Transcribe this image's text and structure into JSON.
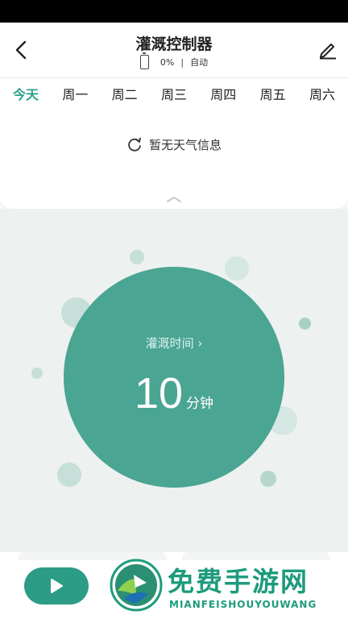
{
  "header": {
    "title": "灌溉控制器",
    "battery_percent": "0%",
    "separator": "|",
    "mode": "自动"
  },
  "tabs": [
    {
      "label": "今天",
      "active": true
    },
    {
      "label": "周一",
      "active": false
    },
    {
      "label": "周二",
      "active": false
    },
    {
      "label": "周三",
      "active": false
    },
    {
      "label": "周四",
      "active": false
    },
    {
      "label": "周五",
      "active": false
    },
    {
      "label": "周六",
      "active": false
    }
  ],
  "weather": {
    "message": "暂无天气信息",
    "icon": "refresh-icon"
  },
  "irrigation": {
    "label": "灌溉时间",
    "chevron": "›",
    "duration_value": "10",
    "duration_unit": "分钟"
  },
  "watermark": {
    "title": "免费手游网",
    "subtitle": "MIANFEISHOUYOUWANG"
  },
  "colors": {
    "accent": "#27a08a",
    "circle": "#4aa593",
    "background": "#edf1ef",
    "bubble": "#c6dfd9"
  },
  "icons": {
    "back": "chevron-left-icon",
    "edit": "pencil-icon",
    "collapse": "chevron-up-icon",
    "play": "play-icon"
  }
}
